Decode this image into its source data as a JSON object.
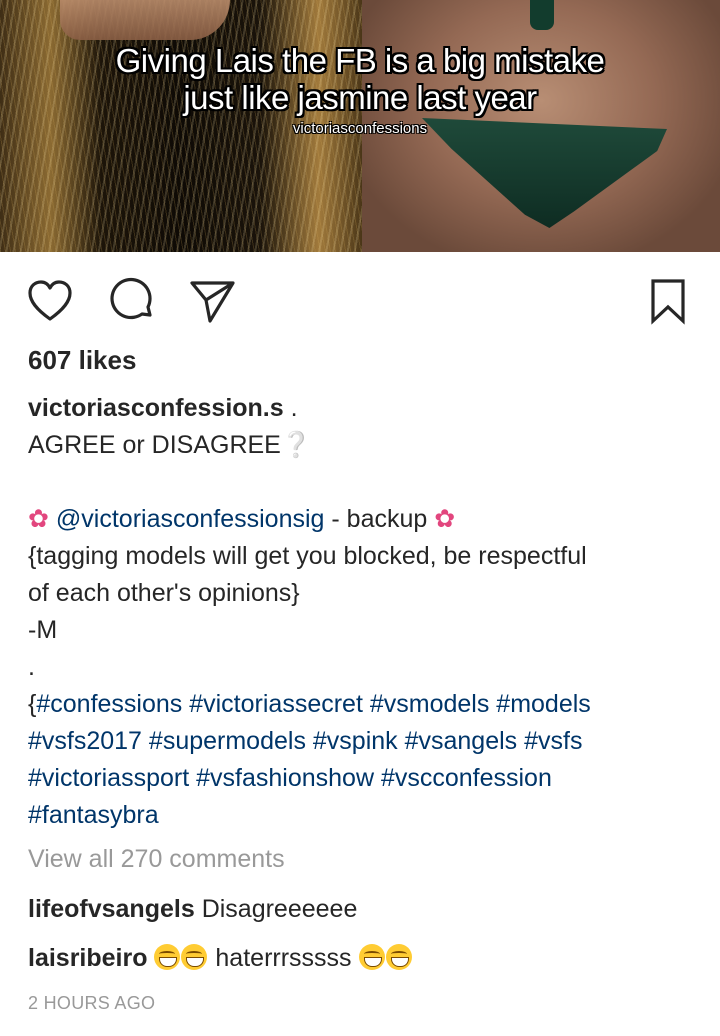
{
  "post": {
    "overlay_lines": [
      "Giving Lais the FB is a big mistake",
      "just like jasmine last year"
    ],
    "watermark": "victoriasconfessions"
  },
  "actions": {
    "like_icon": "heart-outline",
    "comment_icon": "speech-bubble",
    "share_icon": "paper-plane",
    "save_icon": "bookmark-outline"
  },
  "likes": "607 likes",
  "caption": {
    "username": "victoriasconfession.s",
    "username_suffix": " .",
    "line1": "AGREE or DISAGREE",
    "line1_emoji": "❔",
    "flower_left": "✿",
    "mention": "@victoriasconfessionsig",
    "mention_suffix": " - backup ",
    "flower_right": "✿",
    "line3": "{tagging models will get you blocked, be respectful",
    "line4": "of each other's opinions}",
    "line5": "-M",
    "line6": ".",
    "hashtag_prefix": "{",
    "hashtags_line1": "#confessions #victoriassecret #vsmodels #models",
    "hashtags_line2": "#vsfs2017 #supermodels #vspink #vsangels #vsfs",
    "hashtags_line3": "#victoriassport #vsfashionshow #vscconfession",
    "hashtags_line4": "#fantasybra"
  },
  "view_comments": "View all 270 comments",
  "comments": [
    {
      "username": "lifeofvsangels",
      "text": "Disagreeeeee"
    },
    {
      "username": "laisribeiro",
      "text": "haterrrsssss"
    }
  ],
  "timestamp": "2 HOURS AGO",
  "colors": {
    "link": "#003569",
    "muted": "#999999",
    "text": "#262626"
  }
}
